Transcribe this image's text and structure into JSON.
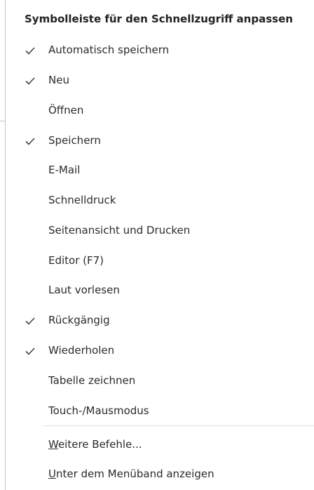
{
  "menu": {
    "title": "Symbolleiste für den Schnellzugriff anpassen",
    "items": [
      {
        "label": "Automatisch speichern",
        "checked": true
      },
      {
        "label": "Neu",
        "checked": true
      },
      {
        "label": "Öffnen",
        "checked": false
      },
      {
        "label": "Speichern",
        "checked": true
      },
      {
        "label": "E-Mail",
        "checked": false
      },
      {
        "label": "Schnelldruck",
        "checked": false
      },
      {
        "label": "Seitenansicht und Drucken",
        "checked": false
      },
      {
        "label": "Editor (F7)",
        "checked": false
      },
      {
        "label": "Laut vorlesen",
        "checked": false
      },
      {
        "label": "Rückgängig",
        "checked": true
      },
      {
        "label": "Wiederholen",
        "checked": true
      },
      {
        "label": "Tabelle zeichnen",
        "checked": false
      },
      {
        "label": "Touch-/Mausmodus",
        "checked": false
      }
    ],
    "more_commands": "Weitere Befehle...",
    "show_below_ribbon": "Unter dem Menüband anzeigen"
  },
  "icons": {
    "check": "check-icon"
  },
  "colors": {
    "text": "#2b2b2b",
    "title": "#222222",
    "check": "#444444",
    "separator": "#dcdcdc"
  }
}
